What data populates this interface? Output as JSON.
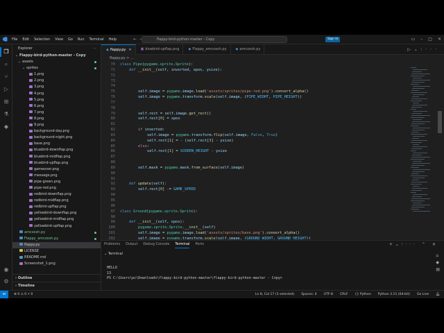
{
  "titlebar": {
    "menu": [
      "File",
      "Edit",
      "Selection",
      "View",
      "Go",
      "Run",
      "Terminal",
      "Help"
    ],
    "search": "flappy-bird-python-master - Copy",
    "signin": "Sign In"
  },
  "sidebar": {
    "title": "Explorer",
    "root": "Flappy-bird-python-master - Copy",
    "items": [
      {
        "label": "assets",
        "kind": "folder"
      },
      {
        "label": "sprites",
        "kind": "folder"
      },
      {
        "label": "1.png",
        "kind": "png"
      },
      {
        "label": "2.png",
        "kind": "png"
      },
      {
        "label": "3.png",
        "kind": "png"
      },
      {
        "label": "4.png",
        "kind": "png"
      },
      {
        "label": "5.png",
        "kind": "png"
      },
      {
        "label": "6.png",
        "kind": "png"
      },
      {
        "label": "7.png",
        "kind": "png"
      },
      {
        "label": "8.png",
        "kind": "png"
      },
      {
        "label": "9.png",
        "kind": "png"
      },
      {
        "label": "background-day.png",
        "kind": "png"
      },
      {
        "label": "background-night.png",
        "kind": "png"
      },
      {
        "label": "base.png",
        "kind": "png"
      },
      {
        "label": "bluebird-downflap.png",
        "kind": "png"
      },
      {
        "label": "bluebird-midflap.png",
        "kind": "png"
      },
      {
        "label": "bluebird-upflap.png",
        "kind": "png"
      },
      {
        "label": "gameover.png",
        "kind": "png"
      },
      {
        "label": "message.png",
        "kind": "png"
      },
      {
        "label": "pipe-green.png",
        "kind": "png"
      },
      {
        "label": "pipe-red.png",
        "kind": "png"
      },
      {
        "label": "redbird-downflap.png",
        "kind": "png"
      },
      {
        "label": "redbird-midflap.png",
        "kind": "png"
      },
      {
        "label": "redbird-upflap.png",
        "kind": "png"
      },
      {
        "label": "yellowbird-downflap.png",
        "kind": "png"
      },
      {
        "label": "yellowbird-midflap.png",
        "kind": "png"
      },
      {
        "label": "yellowbird-upflap.png",
        "kind": "png"
      },
      {
        "label": "amcoxsh.py",
        "kind": "py"
      },
      {
        "label": "Flappy_amcoxsh.py",
        "kind": "py"
      },
      {
        "label": "flappy.py",
        "kind": "py"
      },
      {
        "label": "LICENSE",
        "kind": "lic"
      },
      {
        "label": "README.md",
        "kind": "md"
      },
      {
        "label": "Screenshot_1.png",
        "kind": "png"
      }
    ],
    "outline": "Outline",
    "timeline": "Timeline"
  },
  "tabs": [
    {
      "label": "flappy.py",
      "active": true
    },
    {
      "label": "bluebird-upflap.png",
      "active": false
    },
    {
      "label": "Flappy_amcoxsh.py",
      "active": false
    },
    {
      "label": "amcoxsh.py",
      "active": false
    }
  ],
  "breadcrumb": "flappy.py > ...",
  "code": [
    {
      "n": "70",
      "html": "<span class='kw'>class</span> <span class='cls'>Pipe</span><span class='txt'>(</span><span class='cls'>pygame</span><span class='txt'>.</span><span class='cls'>sprite</span><span class='txt'>.</span><span class='cls'>Sprite</span><span class='txt'>):</span>",
      "indent": 0
    },
    {
      "n": "71",
      "html": "<span class='kw'>def</span> <span class='fn'>__init__</span><span class='txt'>(</span><span class='var'>self</span><span class='txt'>, </span><span class='var'>inverted</span><span class='txt'>, </span><span class='var'>xpos</span><span class='txt'>, </span><span class='var'>ysize</span><span class='txt'>):</span>",
      "indent": 1
    },
    {
      "n": "72",
      "html": "",
      "indent": 0
    },
    {
      "n": "73",
      "html": "",
      "indent": 0
    },
    {
      "n": "74",
      "html": "",
      "indent": 0
    },
    {
      "n": "75",
      "html": "<span class='var'>self</span><span class='txt'>.</span><span class='var'>image</span><span class='txt'> = </span><span class='cls'>pygame</span><span class='txt'>.</span><span class='var'>image</span><span class='txt'>.</span><span class='fn'>load</span><span class='txt'>(</span><span class='str'>'assets/sprites/pipe-red.png'</span><span class='txt'>).</span><span class='fn'>convert_alpha</span><span class='txt'>()</span>",
      "indent": 2
    },
    {
      "n": "76",
      "html": "<span class='var'>self</span><span class='txt'>.</span><span class='var'>image</span><span class='txt'> = </span><span class='cls'>pygame</span><span class='txt'>.</span><span class='var'>transform</span><span class='txt'>.</span><span class='fn'>scale</span><span class='txt'>(</span><span class='var'>self</span><span class='txt'>.</span><span class='var'>image</span><span class='txt'>, (</span><span class='const'>PIPE_WIDHT</span><span class='txt'>, </span><span class='const'>PIPE_HEIGHT</span><span class='txt'>))</span>",
      "indent": 2
    },
    {
      "n": "77",
      "html": "",
      "indent": 0
    },
    {
      "n": "78",
      "html": "",
      "indent": 0
    },
    {
      "n": "79",
      "html": "<span class='var'>self</span><span class='txt'>.</span><span class='var'>rect</span><span class='txt'> = </span><span class='var'>self</span><span class='txt'>.</span><span class='var'>image</span><span class='txt'>.</span><span class='fn'>get_rect</span><span class='txt'>()</span>",
      "indent": 2
    },
    {
      "n": "80",
      "html": "<span class='var'>self</span><span class='txt'>.</span><span class='var'>rect</span><span class='txt'>[</span><span class='num'>0</span><span class='txt'>] = </span><span class='var'>xpos</span>",
      "indent": 2
    },
    {
      "n": "81",
      "html": "",
      "indent": 0
    },
    {
      "n": "82",
      "html": "<span class='kw2'>if</span> <span class='var'>inverted</span><span class='txt'>:</span>",
      "indent": 2
    },
    {
      "n": "83",
      "html": "<span class='var'>self</span><span class='txt'>.</span><span class='var'>image</span><span class='txt'> = </span><span class='cls'>pygame</span><span class='txt'>.</span><span class='var'>transform</span><span class='txt'>.</span><span class='fn'>flip</span><span class='txt'>(</span><span class='var'>self</span><span class='txt'>.</span><span class='var'>image</span><span class='txt'>, </span><span class='kw'>False</span><span class='txt'>, </span><span class='kw'>True</span><span class='txt'>)</span>",
      "indent": 3
    },
    {
      "n": "84",
      "html": "<span class='var'>self</span><span class='txt'>.</span><span class='var'>rect</span><span class='txt'>[</span><span class='num'>1</span><span class='txt'>] = - (</span><span class='var'>self</span><span class='txt'>.</span><span class='var'>rect</span><span class='txt'>[</span><span class='num'>3</span><span class='txt'>] - </span><span class='var'>ysize</span><span class='txt'>)</span>",
      "indent": 3
    },
    {
      "n": "85",
      "html": "<span class='kw2'>else</span><span class='txt'>:</span>",
      "indent": 2
    },
    {
      "n": "86",
      "html": "<span class='var'>self</span><span class='txt'>.</span><span class='var'>rect</span><span class='txt'>[</span><span class='num'>1</span><span class='txt'>] = </span><span class='const'>SCREEN_HEIGHT</span><span class='txt'> - </span><span class='var'>ysize</span>",
      "indent": 3
    },
    {
      "n": "87",
      "html": "",
      "indent": 0
    },
    {
      "n": "88",
      "html": "",
      "indent": 0
    },
    {
      "n": "89",
      "html": "<span class='var'>self</span><span class='txt'>.</span><span class='var'>mask</span><span class='txt'> = </span><span class='cls'>pygame</span><span class='txt'>.</span><span class='var'>mask</span><span class='txt'>.</span><span class='fn'>from_surface</span><span class='txt'>(</span><span class='var'>self</span><span class='txt'>.</span><span class='var'>image</span><span class='txt'>)</span>",
      "indent": 2
    },
    {
      "n": "90",
      "html": "",
      "indent": 0
    },
    {
      "n": "91",
      "html": "",
      "indent": 0
    },
    {
      "n": "92",
      "html": "<span class='kw'>def</span> <span class='fn'>update</span><span class='txt'>(</span><span class='var'>self</span><span class='txt'>):</span>",
      "indent": 1
    },
    {
      "n": "93",
      "html": "<span class='var'>self</span><span class='txt'>.</span><span class='var'>rect</span><span class='txt'>[</span><span class='num'>0</span><span class='txt'>] -= </span><span class='const'>GAME_SPEED</span>",
      "indent": 2
    },
    {
      "n": "94",
      "html": "",
      "indent": 0
    },
    {
      "n": "95",
      "html": "",
      "indent": 0
    },
    {
      "n": "96",
      "html": "",
      "indent": 0
    },
    {
      "n": "97",
      "html": "<span class='kw'>class</span> <span class='cls'>Ground</span><span class='txt'>(</span><span class='cls'>pygame</span><span class='txt'>.</span><span class='cls'>sprite</span><span class='txt'>.</span><span class='cls'>Sprite</span><span class='txt'>):</span>",
      "indent": 0
    },
    {
      "n": "98",
      "html": "",
      "indent": 0
    },
    {
      "n": "99",
      "html": "<span class='kw'>def</span> <span class='fn'>__init__</span><span class='txt'>(</span><span class='var'>self</span><span class='txt'>, </span><span class='var'>xpos</span><span class='txt'>):</span>",
      "indent": 1
    },
    {
      "n": "100",
      "html": "<span class='cls'>pygame</span><span class='txt'>.</span><span class='cls'>sprite</span><span class='txt'>.</span><span class='cls'>Sprite</span><span class='txt'>.</span><span class='fn'>__init__</span><span class='txt'>(</span><span class='var'>self</span><span class='txt'>)</span>",
      "indent": 2
    },
    {
      "n": "101",
      "html": "<span class='var'>self</span><span class='txt'>.</span><span class='var'>image</span><span class='txt'> = </span><span class='cls'>pygame</span><span class='txt'>.</span><span class='var'>image</span><span class='txt'>.</span><span class='fn'>load</span><span class='txt'>(</span><span class='str'>'assets/sprites/base.png'</span><span class='txt'>).</span><span class='fn'>convert_alpha</span><span class='txt'>()</span>",
      "indent": 2
    },
    {
      "n": "102",
      "html": "<span class='var'>self</span><span class='txt'>.</span><span class='var'>image</span><span class='txt'> = </span><span class='cls'>pygame</span><span class='txt'>.</span><span class='var'>transform</span><span class='txt'>.</span><span class='fn'>scale</span><span class='txt'>(</span><span class='var'>self</span><span class='txt'>.</span><span class='var'>image</span><span class='txt'>, (</span><span class='const'>GROUND_WIDHT</span><span class='txt'>, </span><span class='const'>GROUND_HEIGHT</span><span class='txt'>))</span>",
      "indent": 2
    },
    {
      "n": "103",
      "html": "",
      "indent": 0
    },
    {
      "n": "104",
      "html": "<span class='var'>self</span><span class='txt'>.</span><span class='var'>mask</span><span class='txt'> = </span><span class='cls'>pygame</span><span class='txt'>.</span><span class='var'>mask</span><span class='txt'>.</span><span class='fn'>from_surface</span><span class='txt'>(</span><span class='var'>self</span><span class='txt'>.</span><span class='var'>image</span><span class='txt'>)</span>",
      "indent": 2
    }
  ],
  "panel": {
    "tabs": [
      "Problems",
      "Output",
      "Debug Console",
      "Terminal",
      "Ports"
    ],
    "active_tab": "Terminal",
    "terminal_label": "Terminal",
    "lines": [
      "HELLO",
      "13",
      "PS C:\\Users\\pc\\Downloads\\flappy-bird-python-master\\flappy-bird-python-master - Copy> "
    ]
  },
  "status": {
    "left": "⊗ 0 ⚠ 0  ⚡ 0",
    "items": [
      "Ln 8, Col 17 (3 selected)",
      "Spaces: 4",
      "UTF-8",
      "CRLF",
      "{} Python",
      "Python 3.11 (64-bit)",
      "Go Live"
    ]
  },
  "icons": {
    "activity": [
      "files-icon",
      "search-icon",
      "source-control-icon",
      "run-debug-icon",
      "extensions-icon",
      "testing-icon",
      "python-icon"
    ],
    "accent": "#0078d4"
  }
}
